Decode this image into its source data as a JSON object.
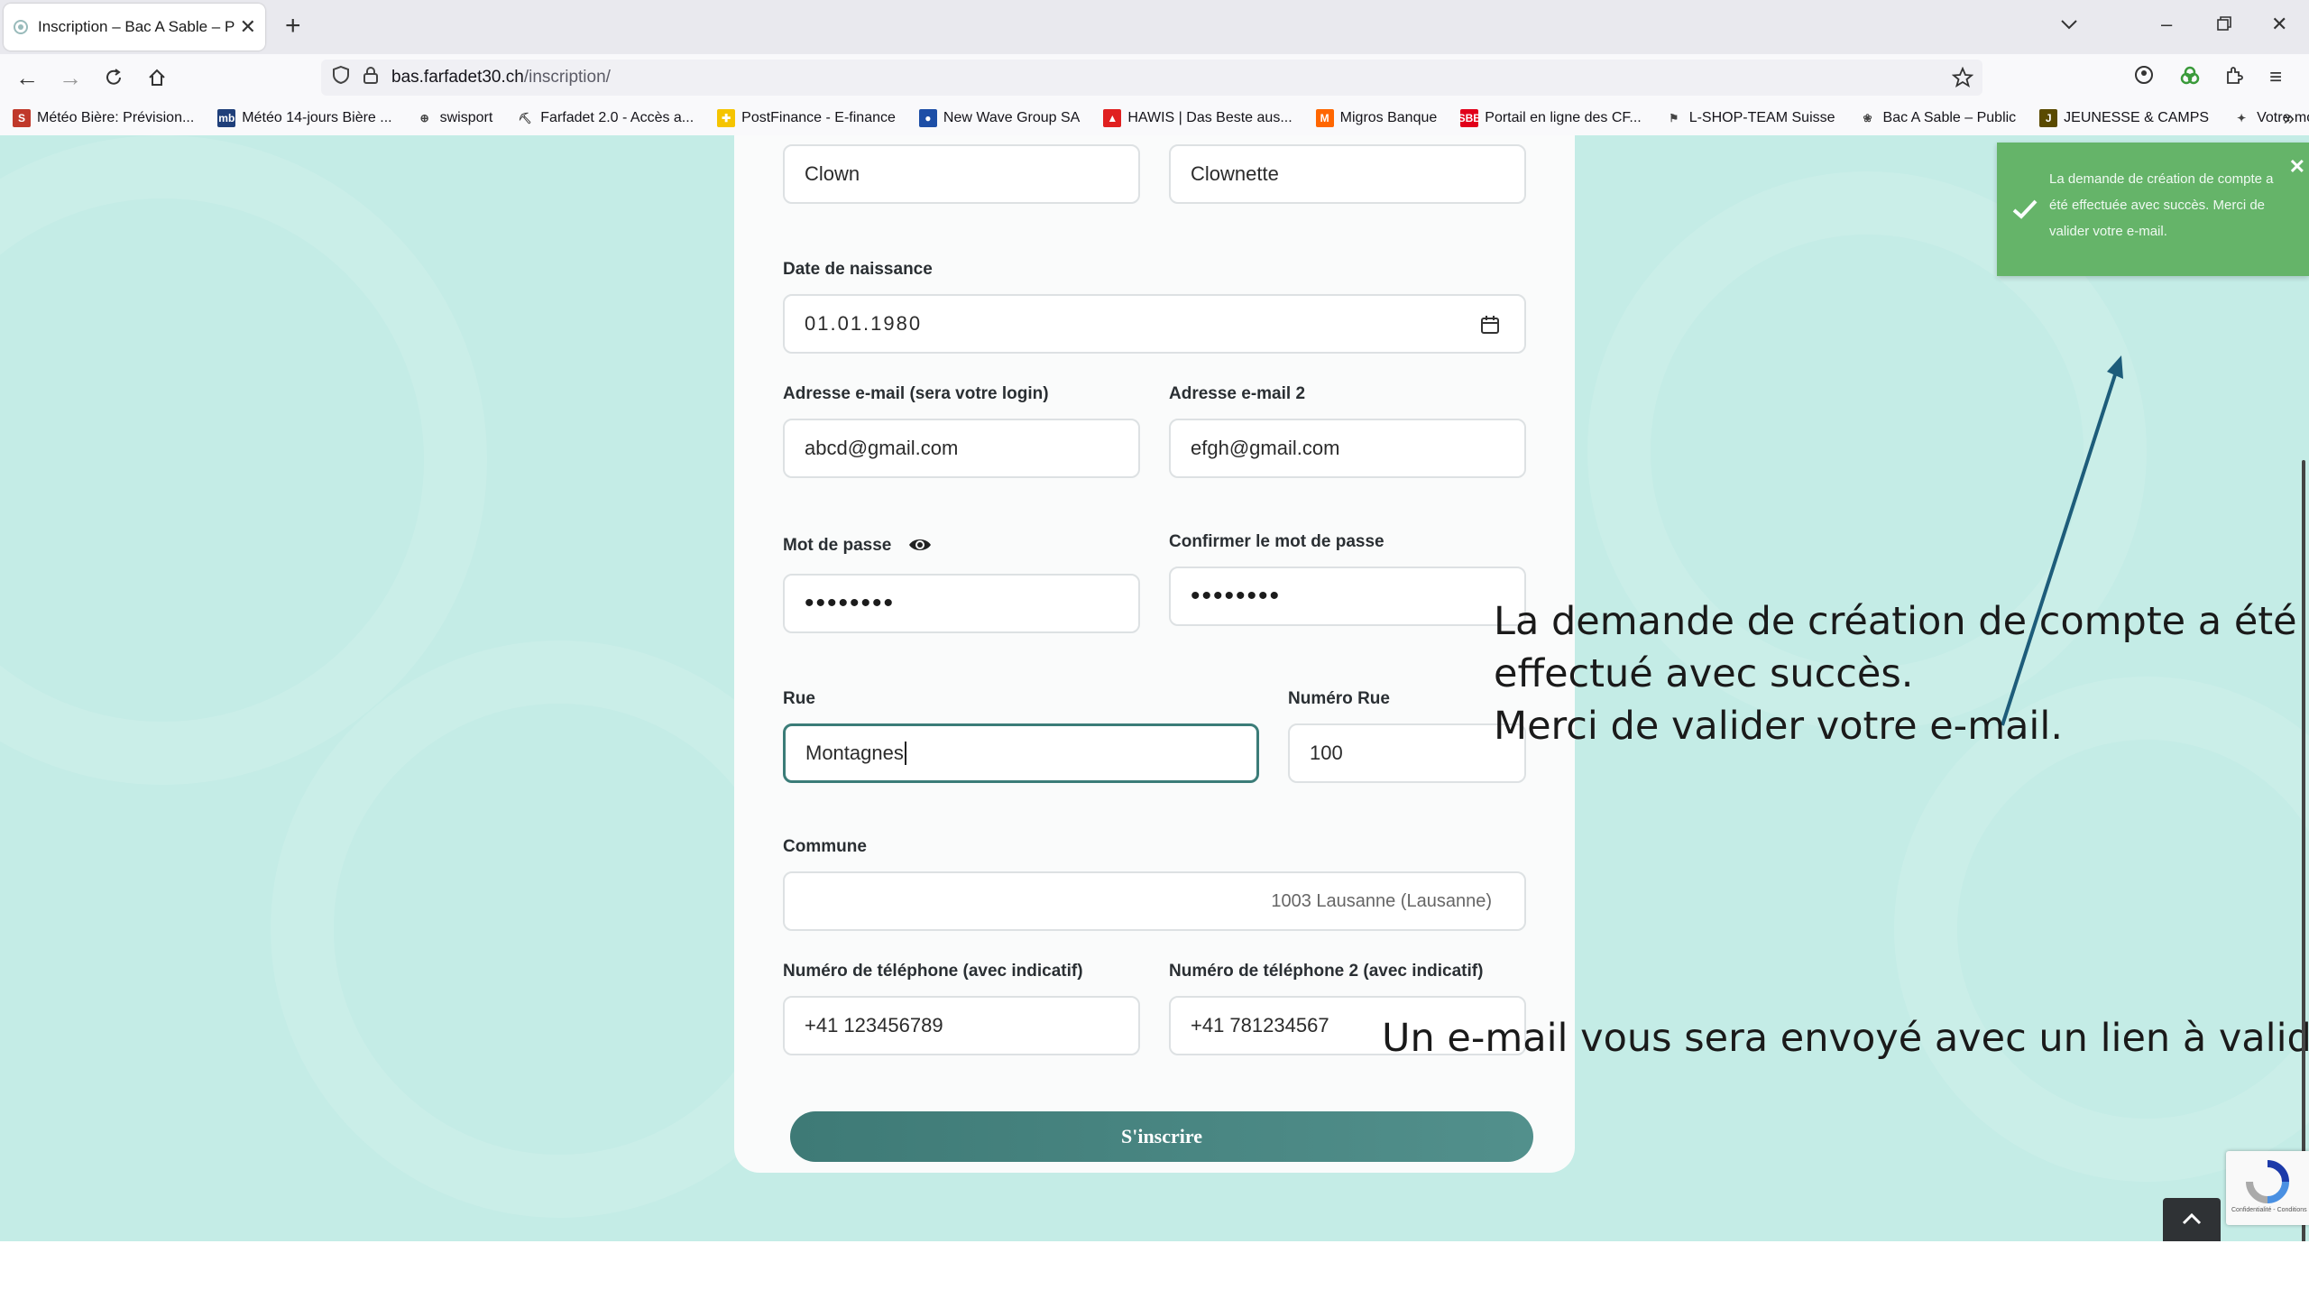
{
  "browser": {
    "tab_title": "Inscription – Bac A Sable – Pass",
    "url_host": "bas.farfadet30.ch",
    "url_path": "/inscription/",
    "bookmarks": [
      {
        "label": "Météo Bière: Prévision...",
        "icon": "S",
        "color": "#c0392b"
      },
      {
        "label": "Météo 14-jours Bière ...",
        "icon": "mb",
        "color": "#1f3f7a"
      },
      {
        "label": "swisport",
        "icon": "⊕",
        "color": "transparent"
      },
      {
        "label": "Farfadet 2.0 - Accès a...",
        "icon": "⛏",
        "color": "transparent"
      },
      {
        "label": "PostFinance - E-finance",
        "icon": "✚",
        "color": "#f5c400"
      },
      {
        "label": "New Wave Group SA",
        "icon": "●",
        "color": "#1d4ea6"
      },
      {
        "label": "HAWIS | Das Beste aus...",
        "icon": "▲",
        "color": "#e02020"
      },
      {
        "label": "Migros Banque",
        "icon": "M",
        "color": "#ff6600"
      },
      {
        "label": "Portail en ligne des CF...",
        "icon": "SBB",
        "color": "#e1001a"
      },
      {
        "label": "L-SHOP-TEAM Suisse",
        "icon": "⚑",
        "color": "transparent"
      },
      {
        "label": "Bac A Sable – Public",
        "icon": "❀",
        "color": "transparent"
      },
      {
        "label": "JEUNESSE & CAMPS",
        "icon": "J",
        "color": "#5a4a00"
      },
      {
        "label": "Votre moteur de reche...",
        "icon": "✦",
        "color": "transparent"
      }
    ]
  },
  "form": {
    "first_name": "Clown",
    "last_name": "Clownette",
    "birthdate_label": "Date de naissance",
    "birthdate_value": "01.01.1980",
    "email_label": "Adresse e-mail (sera votre login)",
    "email_value": "abcd@gmail.com",
    "email2_label": "Adresse e-mail 2",
    "email2_value": "efgh@gmail.com",
    "password_label": "Mot de passe",
    "password_value": "••••••••",
    "password_confirm_label": "Confirmer le mot de passe",
    "password_confirm_value": "••••••••",
    "street_label": "Rue",
    "street_value": "Montagnes",
    "street_number_label": "Numéro Rue",
    "street_number_value": "100",
    "commune_label": "Commune",
    "commune_value": "1003 Lausanne (Lausanne)",
    "phone_label": "Numéro de téléphone (avec indicatif)",
    "phone_value": "+41 123456789",
    "phone2_label": "Numéro de téléphone 2 (avec indicatif)",
    "phone2_value": "+41 781234567",
    "submit_label": "S'inscrire"
  },
  "toast": {
    "message": "La demande de création de compte a été effectuée avec succès. Merci de valider votre e-mail.",
    "color": "#5db05f"
  },
  "annotations": {
    "line1": "La demande de création de compte a été",
    "line2": "effectué avec succès.",
    "line3": "Merci de valider votre e-mail.",
    "email_note": "Un e-mail vous sera envoyé avec un lien à valider."
  },
  "recaptcha": {
    "footer": "Confidentialité - Conditions"
  }
}
